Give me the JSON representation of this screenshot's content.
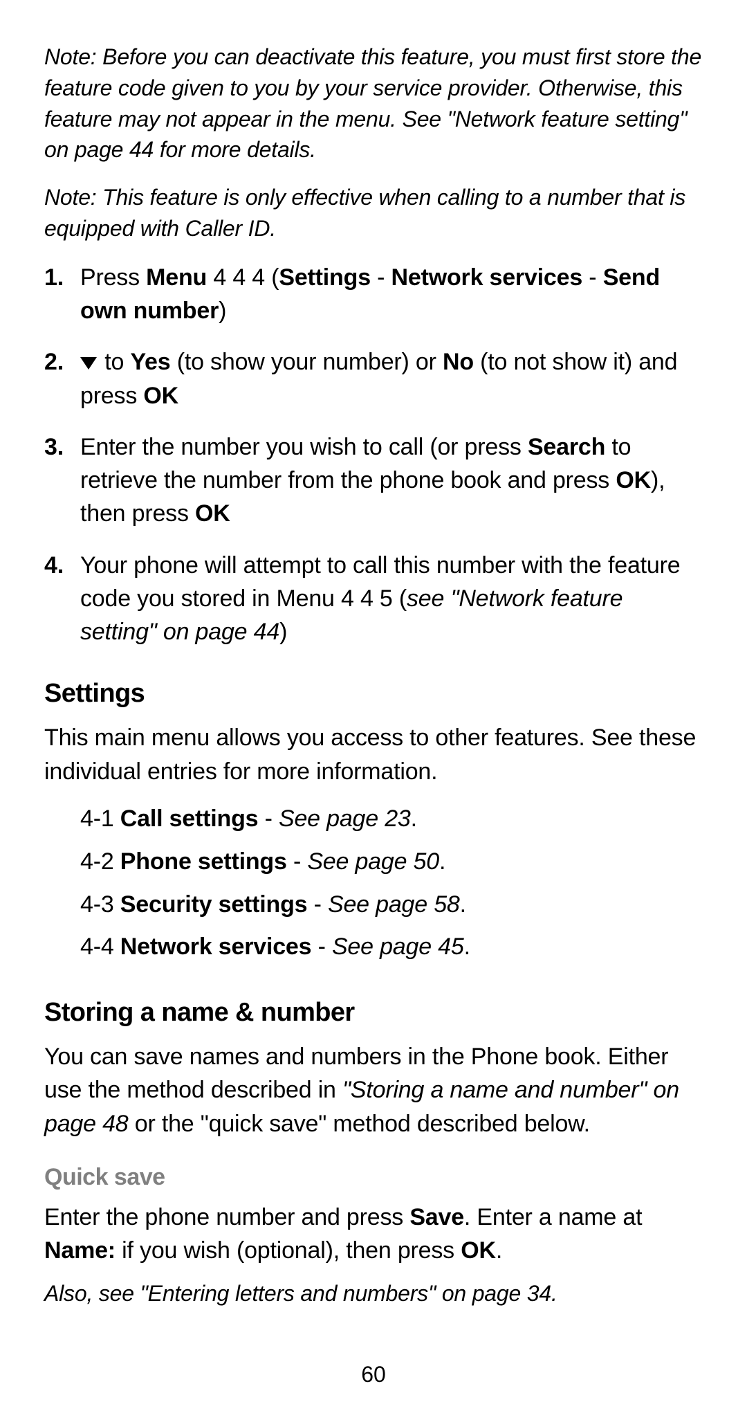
{
  "notes": {
    "n1": "Note: Before you can deactivate this feature, you must first store the feature code given to you by your service provider. Otherwise, this feature may not appear in the menu. See \"Network feature setting\" on page 44 for more details.",
    "n2": "Note: This feature is only effective when calling to a number that is equipped with Caller ID."
  },
  "steps": {
    "s1": {
      "num": "1.",
      "t1": "Press ",
      "b1": "Menu",
      "t2": " 4 4 4 (",
      "b2": "Settings",
      "t3": " - ",
      "b3": "Network services",
      "t4": " - ",
      "b4": "Send own number",
      "t5": ")"
    },
    "s2": {
      "num": "2.",
      "t1": " to ",
      "b1": "Yes",
      "t2": " (to show your number) or ",
      "b2": "No",
      "t3": " (to not show it) and press ",
      "b3": "OK"
    },
    "s3": {
      "num": "3.",
      "t1": "Enter the number you wish to call (or press ",
      "b1": "Search",
      "t2": " to retrieve the number from the phone book and press ",
      "b2": "OK",
      "t3": "), then press ",
      "b3": "OK"
    },
    "s4": {
      "num": "4.",
      "t1": "Your phone will attempt to call this number with the feature code you stored in Menu 4 4 5 (",
      "i1": "see \"Network feature setting\" on page 44",
      "t2": ")"
    }
  },
  "settings": {
    "heading": "Settings",
    "intro": "This main menu allows you access to other features. See these individual entries for more information.",
    "items": [
      {
        "prefix": "4-1 ",
        "name": "Call settings",
        "sep": " - ",
        "ref": "See page 23",
        "dot": "."
      },
      {
        "prefix": "4-2 ",
        "name": "Phone settings",
        "sep": " - ",
        "ref": "See page 50",
        "dot": "."
      },
      {
        "prefix": "4-3 ",
        "name": "Security settings",
        "sep": " - ",
        "ref": "See page 58",
        "dot": "."
      },
      {
        "prefix": "4-4 ",
        "name": "Network services",
        "sep": " - ",
        "ref": "See page 45",
        "dot": "."
      }
    ]
  },
  "storing": {
    "heading": "Storing a name & number",
    "p_t1": "You can save names and numbers in the Phone book. Either use the method described in ",
    "p_i1": "\"Storing a name and number\" on page 48",
    "p_t2": " or the \"quick save\" method described below."
  },
  "quicksave": {
    "heading": "Quick save",
    "p_t1": "Enter the phone number and press ",
    "p_b1": "Save",
    "p_t2": ". Enter a name at ",
    "p_b2": "Name:",
    "p_t3": " if you wish (optional), then press ",
    "p_b3": "OK",
    "p_t4": ".",
    "also": "Also, see \"Entering letters and numbers\" on page 34."
  },
  "pageNumber": "60"
}
